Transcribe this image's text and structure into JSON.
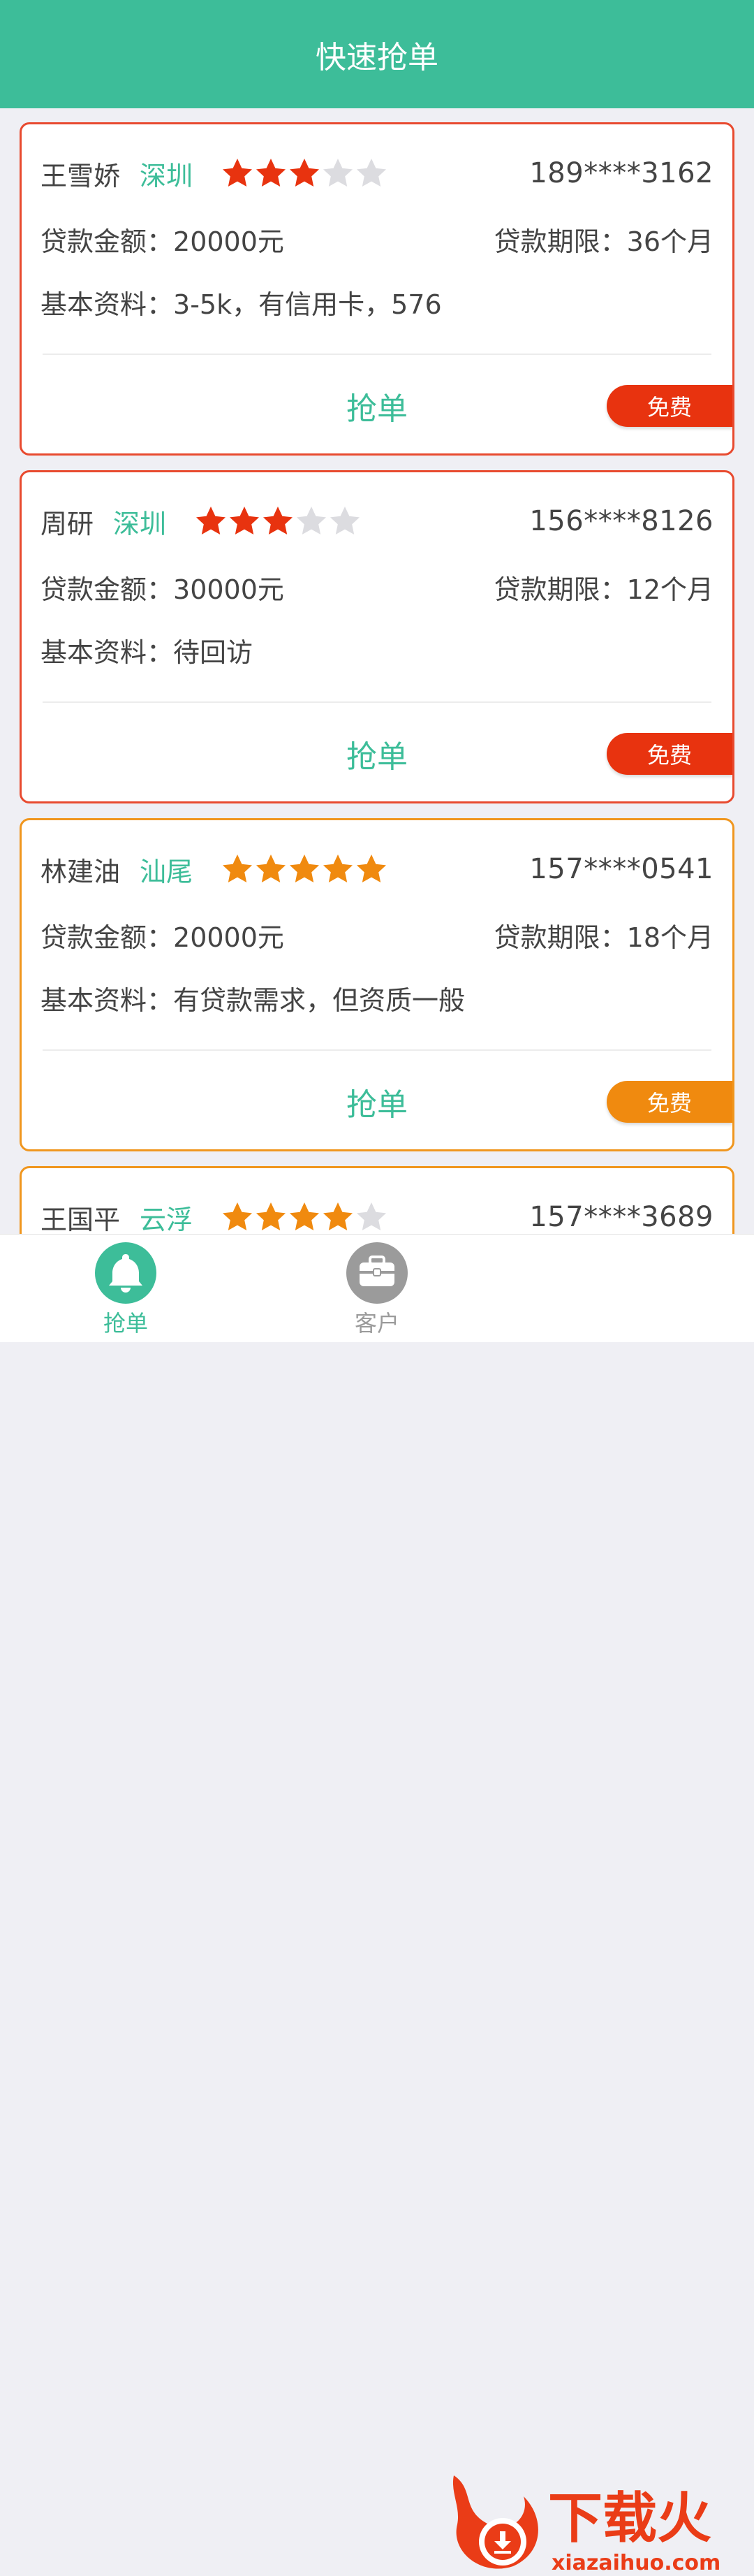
{
  "header": {
    "title": "快速抢单"
  },
  "labels": {
    "amount": "贷款金额：",
    "term": "贷款期限：",
    "info": "基本资料：",
    "grab": "抢单",
    "free": "免费"
  },
  "colors": {
    "primary": "#3dbd99",
    "red_accent": "#e8330f",
    "orange_accent": "#f08a0f",
    "star_gray": "#dcdce0"
  },
  "orders": [
    {
      "name": "王雪娇",
      "city": "深圳",
      "stars": 3,
      "phone": "189****3162",
      "amount": "20000元",
      "term": "36个月",
      "info": "3-5k，有信用卡，576",
      "theme": "red"
    },
    {
      "name": "周研",
      "city": "深圳",
      "stars": 3,
      "phone": "156****8126",
      "amount": "30000元",
      "term": "12个月",
      "info": "待回访",
      "theme": "red"
    },
    {
      "name": "林建油",
      "city": "汕尾",
      "stars": 5,
      "phone": "157****0541",
      "amount": "20000元",
      "term": "18个月",
      "info": "有贷款需求，但资质一般",
      "theme": "orange"
    },
    {
      "name": "王国平",
      "city": "云浮",
      "stars": 4,
      "phone": "157****3689",
      "theme": "orange"
    }
  ],
  "tabs": [
    {
      "label": "抢单",
      "icon": "bell-icon",
      "active": true
    },
    {
      "label": "客户",
      "icon": "briefcase-icon",
      "active": false
    }
  ],
  "watermark": {
    "text": "下载火",
    "url": "xiazaihuo.com",
    "icon": "flame-logo-icon"
  }
}
